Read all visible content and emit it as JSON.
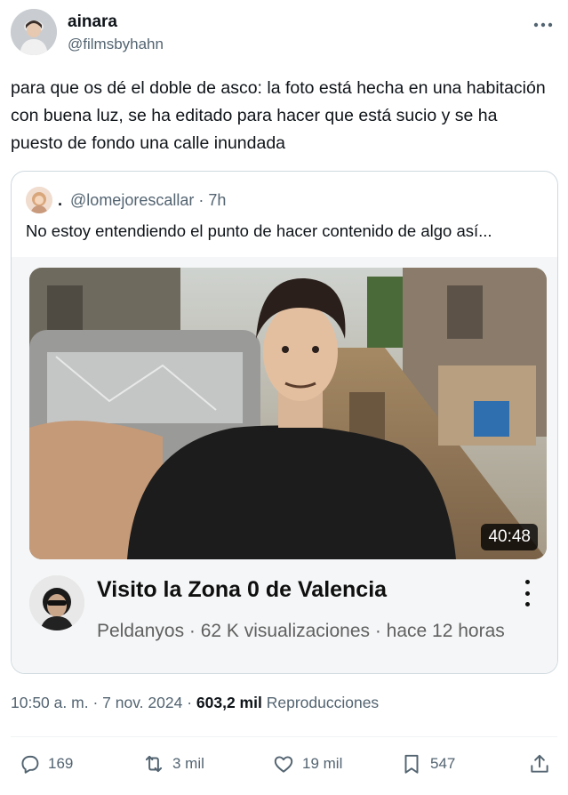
{
  "author": {
    "name": "ainara",
    "handle": "@filmsbyhahn"
  },
  "tweet": {
    "text": "para que os dé el doble de asco: la foto está hecha en una habitación con buena luz, se ha editado para hacer que está sucio y se ha puesto de fondo una calle inundada"
  },
  "quote": {
    "dot": ".",
    "handle": "@lomejorescallar",
    "separator": "·",
    "time": "7h",
    "text": "No estoy entendiendo el punto de hacer contenido de algo así...",
    "video": {
      "duration": "40:48",
      "title": "Visito la Zona 0 de Valencia",
      "meta": "Peldanyos · 62 K visualizaciones · hace 12 horas"
    }
  },
  "timestamp": {
    "time": "10:50 a. m.",
    "sep1": "·",
    "date": "7 nov. 2024",
    "sep2": "·",
    "views": "603,2 mil",
    "views_label": "Reproducciones"
  },
  "actions": {
    "replies": "169",
    "reposts": "3 mil",
    "likes": "19 mil",
    "bookmarks": "547"
  },
  "icons": [
    "more-icon",
    "reply-icon",
    "repost-icon",
    "like-icon",
    "bookmark-icon",
    "share-icon",
    "kebab-icon"
  ],
  "colors": {
    "text": "#0f1419",
    "secondary": "#536471",
    "border": "#cfd9de",
    "divider": "#eff3f4",
    "card_bg": "#f5f6f7"
  }
}
